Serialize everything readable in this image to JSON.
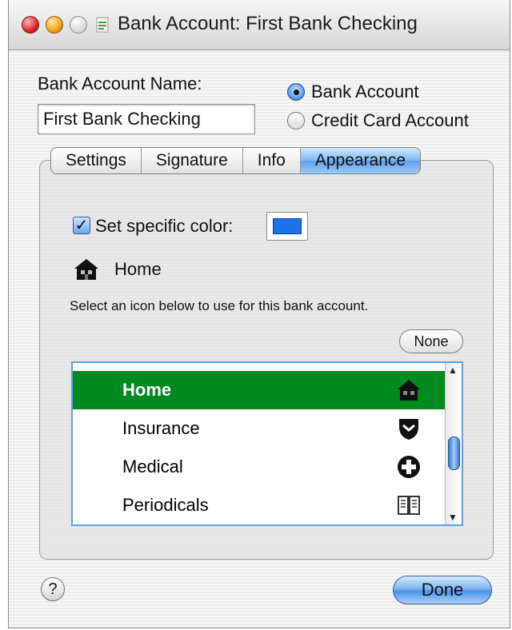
{
  "window": {
    "title": "Bank Account: First Bank Checking"
  },
  "form": {
    "name_label": "Bank Account Name:",
    "name_value": "First Bank Checking",
    "account_types": [
      {
        "label": "Bank Account",
        "selected": true
      },
      {
        "label": "Credit Card Account",
        "selected": false
      }
    ]
  },
  "tabs": [
    {
      "label": "Settings",
      "active": false
    },
    {
      "label": "Signature",
      "active": false
    },
    {
      "label": "Info",
      "active": false
    },
    {
      "label": "Appearance",
      "active": true
    }
  ],
  "appearance": {
    "set_color_label": "Set specific color:",
    "set_color_checked": true,
    "color": "#1d72e8",
    "current_icon_label": "Home",
    "instruction": "Select an icon below to use for this bank account.",
    "none_button": "None",
    "icon_list": [
      {
        "label": "Home",
        "icon": "house-icon",
        "selected": true
      },
      {
        "label": "Insurance",
        "icon": "shield-icon",
        "selected": false
      },
      {
        "label": "Medical",
        "icon": "medical-cross-icon",
        "selected": false
      },
      {
        "label": "Periodicals",
        "icon": "newspaper-icon",
        "selected": false
      }
    ]
  },
  "footer": {
    "help_label": "?",
    "done_button": "Done"
  },
  "colors": {
    "selection": "#008a1f",
    "accent": "#4e93e6"
  }
}
